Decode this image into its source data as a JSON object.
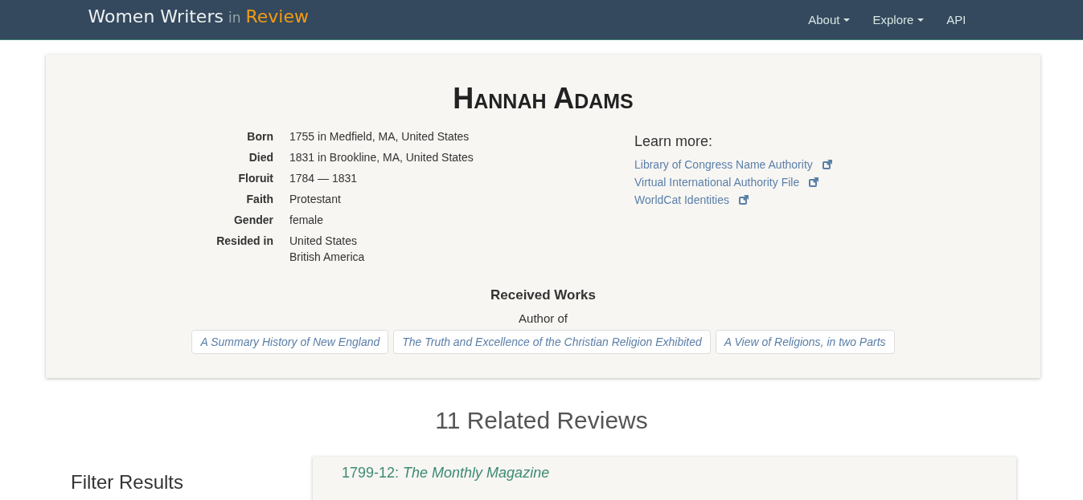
{
  "navbar": {
    "brand": {
      "name": "Women Writers",
      "connector": "in",
      "highlight": "Review"
    },
    "items": [
      {
        "label": "About",
        "dropdown": true
      },
      {
        "label": "Explore",
        "dropdown": true
      },
      {
        "label": "API",
        "dropdown": false
      }
    ]
  },
  "person": {
    "name": "Hannah Adams",
    "facts": [
      {
        "label": "Born",
        "values": [
          "1755 in Medfield, MA, United States"
        ]
      },
      {
        "label": "Died",
        "values": [
          "1831 in Brookline, MA, United States"
        ]
      },
      {
        "label": "Floruit",
        "values": [
          "1784 — 1831"
        ]
      },
      {
        "label": "Faith",
        "values": [
          "Protestant"
        ]
      },
      {
        "label": "Gender",
        "values": [
          "female"
        ]
      },
      {
        "label": "Resided in",
        "values": [
          "United States",
          "British America"
        ]
      }
    ],
    "learn_more": {
      "title": "Learn more:",
      "links": [
        "Library of Congress Name Authority",
        "Virtual International Authority File",
        "WorldCat Identities"
      ]
    },
    "received_works": {
      "title": "Received Works",
      "subtitle": "Author of",
      "works": [
        "A Summary History of New England",
        "The Truth and Excellence of the Christian Religion Exhibited",
        "A View of Religions, in two Parts"
      ]
    }
  },
  "related": {
    "title": "11 Related Reviews",
    "filter_title": "Filter Results",
    "reviews": [
      {
        "date": "1799-12:",
        "source": "The Monthly Magazine"
      }
    ]
  }
}
